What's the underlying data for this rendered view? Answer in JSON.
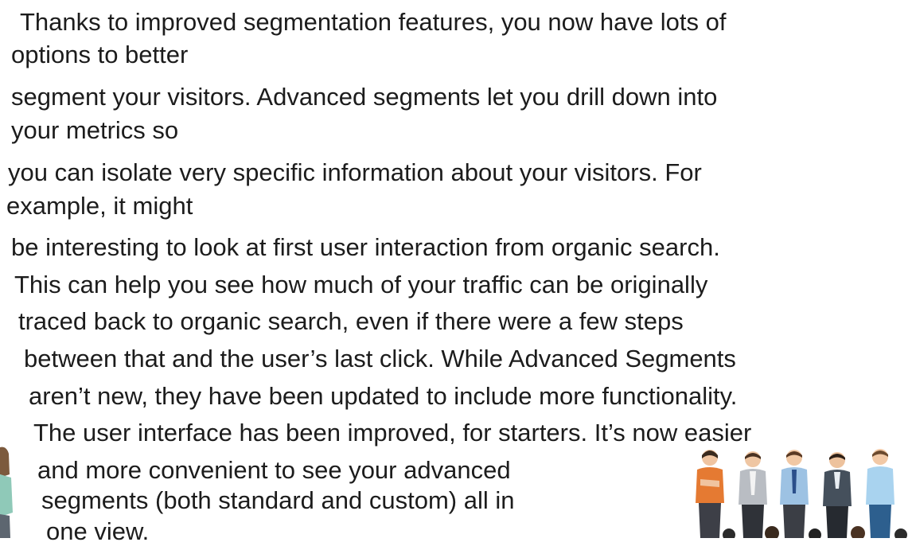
{
  "slide": {
    "lines": [
      "Thanks to improved segmentation features, you now have lots of",
      "options to better",
      "segment your visitors. Advanced segments let you drill down into",
      "your metrics so",
      "you can isolate very specific information about your visitors. For",
      "example, it might",
      "be interesting to look at first user interaction from organic search.",
      "This can help you see how much of your traffic can be originally",
      "traced back to organic search, even if there were a few steps",
      "between that and the user’s last click. While Advanced Segments",
      "aren’t new, they have been updated to include more functionality.",
      "The user interface has been improved, for starters. It’s now easier",
      "and more convenient to see your advanced",
      "segments (both standard and custom) all in",
      "one view."
    ]
  },
  "colors": {
    "text": "#1c1c1c",
    "background": "#ffffff"
  }
}
